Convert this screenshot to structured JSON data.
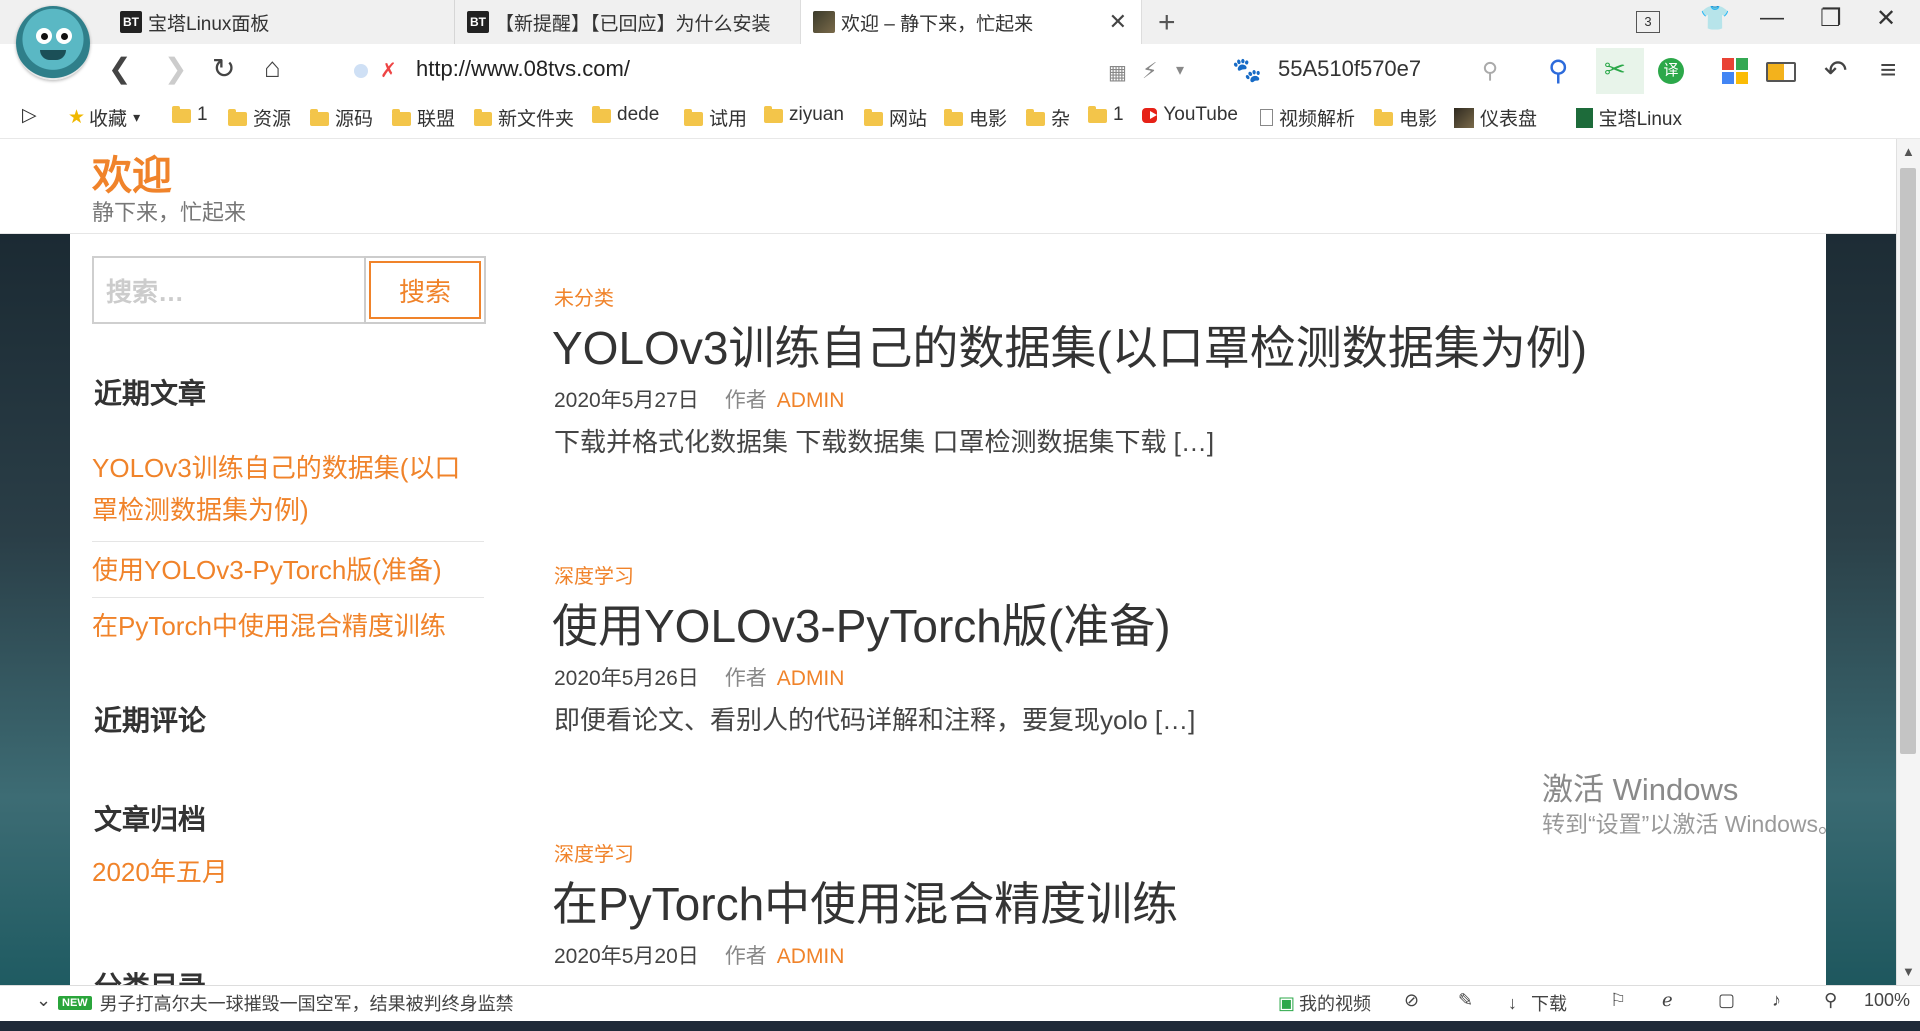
{
  "browser": {
    "tabs": [
      {
        "favicon": "BT",
        "title": "宝塔Linux面板"
      },
      {
        "favicon": "BT",
        "title": "【新提醒】【已回应】为什么安装"
      },
      {
        "favicon": "image",
        "title": "欢迎 – 静下来，忙起来"
      }
    ],
    "tab_count": "3",
    "url": "http://www.08tvs.com/",
    "search_text": "55A510f570e7",
    "bookmarks": [
      "收藏",
      "1",
      "资源",
      "源码",
      "联盟",
      "新文件夹",
      "dede",
      "试用",
      "ziyuan",
      "网站",
      "电影",
      "杂",
      "1",
      "YouTube",
      "视频解析",
      "电影",
      "仪表盘",
      "宝塔Linux"
    ]
  },
  "site": {
    "title": "欢迎",
    "description": "静下来，忙起来",
    "accent_color": "#f0832a"
  },
  "sidebar": {
    "search_placeholder": "搜索…",
    "search_button": "搜索",
    "recent_posts_title": "近期文章",
    "recent_posts": [
      {
        "line1": "YOLOv3训练自己的数据集(以口",
        "line2": "罩检测数据集为例)"
      },
      {
        "line1": "使用YOLOv3-PyTorch版(准备)"
      },
      {
        "line1": "在PyTorch中使用混合精度训练"
      }
    ],
    "recent_comments_title": "近期评论",
    "archives_title": "文章归档",
    "archives": [
      "2020年五月"
    ],
    "categories_title": "分类目录"
  },
  "posts": [
    {
      "category": "未分类",
      "title": "YOLOv3训练自己的数据集(以口罩检测数据集为例)",
      "date": "2020年5月27日",
      "by": "作者",
      "author": "ADMIN",
      "excerpt": "下载并格式化数据集 下载数据集 口罩检测数据集下载 […]"
    },
    {
      "category": "深度学习",
      "title": "使用YOLOv3-PyTorch版(准备)",
      "date": "2020年5月26日",
      "by": "作者",
      "author": "ADMIN",
      "excerpt": "即便看论文、看别人的代码详解和注释，要复现yolo […]"
    },
    {
      "category": "深度学习",
      "title": "在PyTorch中使用混合精度训练",
      "date": "2020年5月20日",
      "by": "作者",
      "author": "ADMIN",
      "excerpt": ""
    }
  ],
  "watermark": {
    "line1": "激活 Windows",
    "line2": "转到“设置”以激活 Windows。"
  },
  "statusbar": {
    "badge": "NEW",
    "news": "男子打高尔夫一球摧毁一国空军，结果被判终身监禁",
    "my_video": "我的视频",
    "download": "下载",
    "zoom": "100%"
  }
}
